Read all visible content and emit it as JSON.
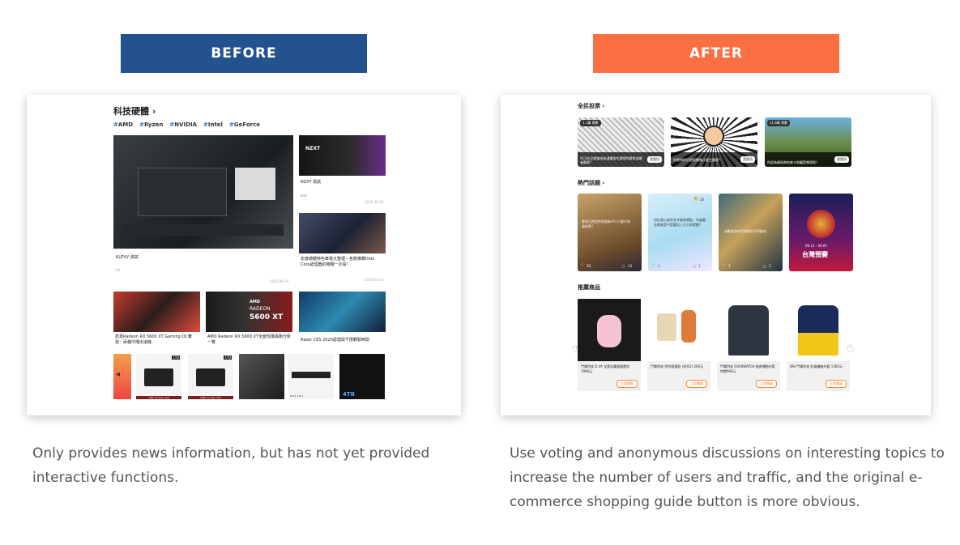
{
  "before": {
    "banner": "BEFORE",
    "color": "#23528f",
    "section_title": "科技硬體 ›",
    "tags": [
      "AMD",
      "Ryzen",
      "NVIDIA",
      "Intel",
      "GeForce"
    ],
    "main_article": {
      "title": "KLEVV 測試",
      "meta": "20",
      "date": "2020-06-10"
    },
    "side_articles": [
      {
        "badge": "硬體評測",
        "title": "NZXT 測試",
        "meta": "編者",
        "date": "2020-06-28"
      },
      {
        "badge": "硬體評測",
        "title": "年度總體特色筆電大整理－各款推薦Intel Core處理器的機種一次看！",
        "meta": "會員整理",
        "date": "2020-01-23"
      }
    ],
    "row_articles": [
      {
        "title": "技嘉Radeon RX 5600 XT Gaming OC實測：兩種中階出道機"
      },
      {
        "title": "AMD Radeon RX 5600 XT全面性優異跑分新一覽"
      },
      {
        "title": "Razer CES 2020處理與千億轉製時間"
      }
    ],
    "image_texts": {
      "nzxt": "NZXT",
      "amd": "AMD",
      "radeon": "RADEON",
      "xt": "5600 XT",
      "wd1": "1TB",
      "wd2": "1TB",
      "usb": "USB 3.2 Gen 2x2",
      "pcie": "PCI-E / M.2",
      "tb4": "4TB"
    },
    "caption": "Only provides news information, but has not yet provided interactive functions."
  },
  "after": {
    "banner": "AFTER",
    "color": "#fb6f43",
    "vote_title": "全民投票 ›",
    "vote_cards": [
      {
        "count": "1.1萬 票數",
        "title": "ACG作品都會成為漫畫角色實際的觀眾或讀者觀察？",
        "btn": "我要投"
      },
      {
        "count": "",
        "title": "你覺得的沉思經驗像什麼主題呢？",
        "btn": "我要投"
      },
      {
        "count": "11.8萬 票數",
        "title": "你認為最經典的麥卡地圖是哪個呢？",
        "btn": "我要投"
      }
    ],
    "hot_title": "熱門話題 ›",
    "hot_cards": [
      {
        "text": "哪些日常是你知道有不少人都不知道的呢？",
        "likes": "20",
        "comments": "14"
      },
      {
        "text": "對在我心底的名字能夠想起，年度最佳歌曲是不是要記上大大的提醒？",
        "top_likes": "20",
        "likes": "3",
        "comments": "1"
      },
      {
        "text": "流動角色的世界都在不停進化",
        "likes": "1",
        "comments": "1"
      },
      {
        "text": "台灣預賽",
        "date": "08.13 - 09.05",
        "likes": "",
        "comments": ""
      }
    ],
    "rec_title": "推薦商品",
    "products": [
      {
        "title": "鬥陣特攻 D.VA 全套珍藏限量禮包 1990元",
        "btn": "立即購買"
      },
      {
        "title": "鬥陣特攻 特別限量款 (系列2) 200元",
        "btn": "立即購買"
      },
      {
        "title": "鬥陣特攻 OVERWATCH 經典運動外套 特價990元",
        "btn": "立即購買"
      },
      {
        "title": "WH 鬥陣特攻 防風機能外套 1360元",
        "btn": "立即購買"
      }
    ],
    "caption": "Use voting and anonymous discussions on interesting topics to increase the number of users and traffic, and the original e-commerce shopping guide button is more obvious."
  }
}
